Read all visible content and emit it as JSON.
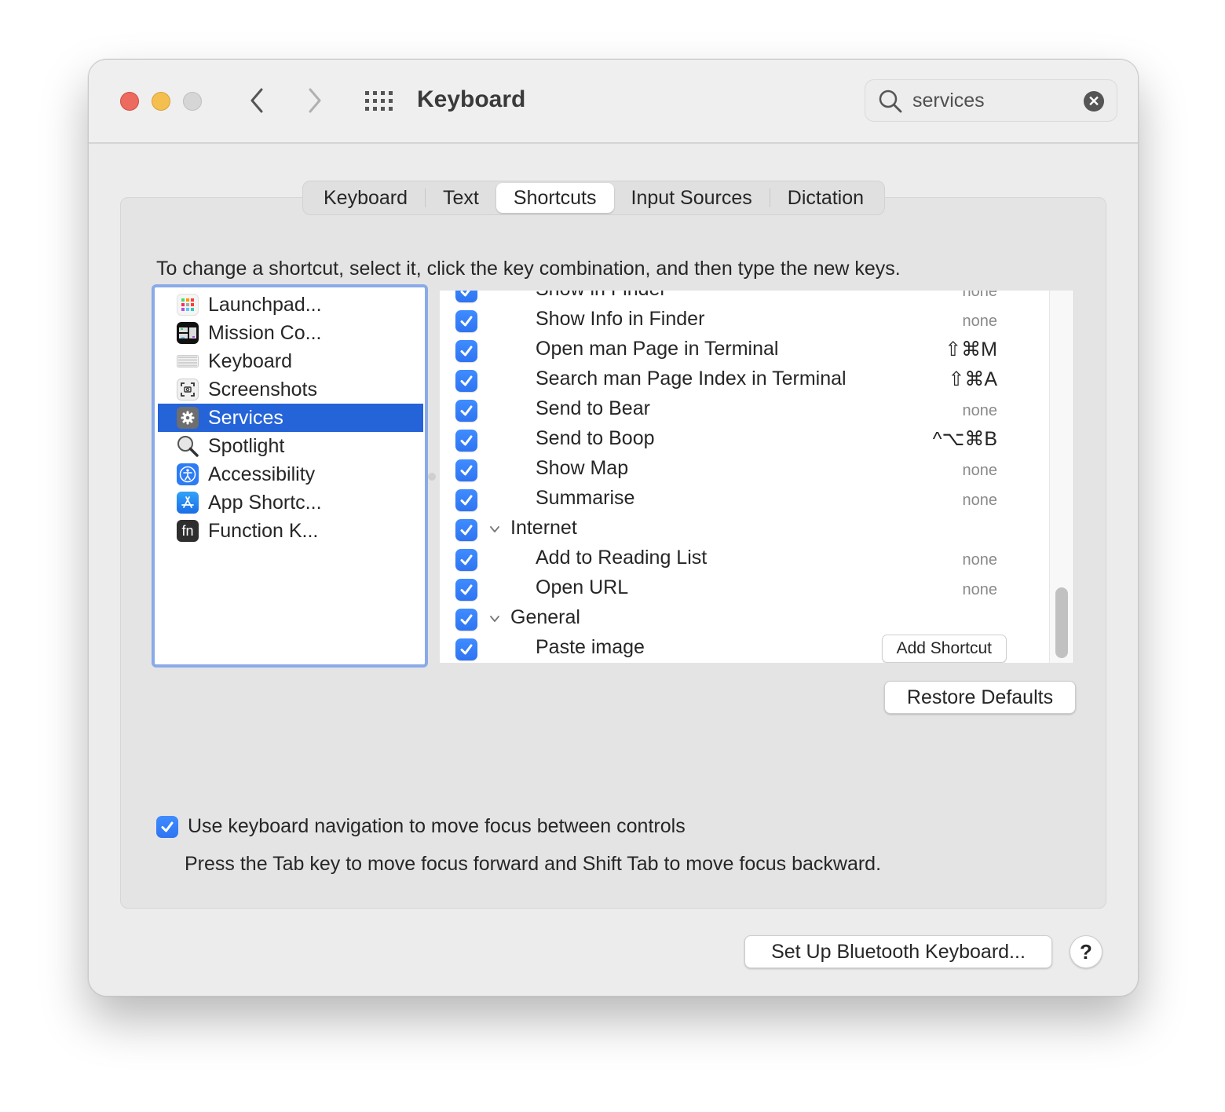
{
  "window": {
    "title": "Keyboard",
    "search": {
      "value": "services",
      "placeholder": "Search"
    }
  },
  "colors": {
    "accent": "#2463d8",
    "checkbox": "#3080f8",
    "focus_ring": "#8aaae8",
    "traffic_red": "#ec6a5e",
    "traffic_yellow": "#f5bf4f",
    "traffic_gray": "#d6d6d6"
  },
  "tabs": [
    {
      "label": "Keyboard",
      "selected": false
    },
    {
      "label": "Text",
      "selected": false
    },
    {
      "label": "Shortcuts",
      "selected": true
    },
    {
      "label": "Input Sources",
      "selected": false
    },
    {
      "label": "Dictation",
      "selected": false
    }
  ],
  "instructions": "To change a shortcut, select it, click the key combination, and then type the new keys.",
  "categories": [
    {
      "label": "Launchpad...",
      "icon": "launchpad-icon",
      "selected": false
    },
    {
      "label": "Mission Co...",
      "icon": "mission-control-icon",
      "selected": false
    },
    {
      "label": "Keyboard",
      "icon": "keyboard-icon",
      "selected": false
    },
    {
      "label": "Screenshots",
      "icon": "screenshots-icon",
      "selected": false
    },
    {
      "label": "Services",
      "icon": "gear-icon",
      "selected": true
    },
    {
      "label": "Spotlight",
      "icon": "magnifier-icon",
      "selected": false
    },
    {
      "label": "Accessibility",
      "icon": "accessibility-icon",
      "selected": false
    },
    {
      "label": "App Shortc...",
      "icon": "app-store-icon",
      "selected": false
    },
    {
      "label": "Function K...",
      "icon": "fn-key-icon",
      "selected": false
    }
  ],
  "services": [
    {
      "label": "Show in Finder",
      "checked": true,
      "shortcut": "none",
      "group": false
    },
    {
      "label": "Show Info in Finder",
      "checked": true,
      "shortcut": "none",
      "group": false
    },
    {
      "label": "Open man Page in Terminal",
      "checked": true,
      "shortcut": "⇧⌘M",
      "group": false
    },
    {
      "label": "Search man Page Index in Terminal",
      "checked": true,
      "shortcut": "⇧⌘A",
      "group": false
    },
    {
      "label": "Send to Bear",
      "checked": true,
      "shortcut": "none",
      "group": false
    },
    {
      "label": "Send to Boop",
      "checked": true,
      "shortcut": "^⌥⌘B",
      "group": false
    },
    {
      "label": "Show Map",
      "checked": true,
      "shortcut": "none",
      "group": false
    },
    {
      "label": "Summarise",
      "checked": true,
      "shortcut": "none",
      "group": false
    },
    {
      "label": "Internet",
      "checked": true,
      "shortcut": "",
      "group": true
    },
    {
      "label": "Add to Reading List",
      "checked": true,
      "shortcut": "none",
      "group": false
    },
    {
      "label": "Open URL",
      "checked": true,
      "shortcut": "none",
      "group": false
    },
    {
      "label": "General",
      "checked": true,
      "shortcut": "",
      "group": true
    },
    {
      "label": "Paste image",
      "checked": true,
      "shortcut": "Add Shortcut",
      "group": false,
      "button": true
    }
  ],
  "buttons": {
    "restore_defaults": "Restore Defaults",
    "bluetooth": "Set Up Bluetooth Keyboard...",
    "help": "?",
    "clear_search": "✕"
  },
  "keyboard_navigation": {
    "checked": true,
    "label": "Use keyboard navigation to move focus between controls",
    "hint": "Press the Tab key to move focus forward and Shift Tab to move focus backward."
  }
}
